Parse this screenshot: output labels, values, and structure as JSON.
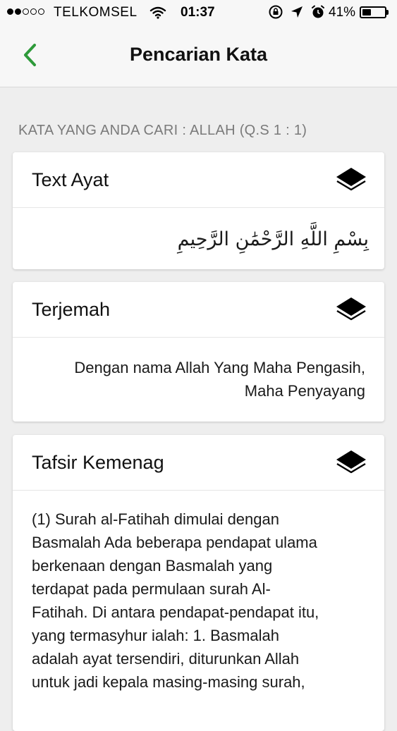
{
  "status_bar": {
    "carrier": "TELKOMSEL",
    "time": "01:37",
    "battery_percent": "41%",
    "battery_level": 0.41,
    "signal_bars_filled": 2,
    "signal_bars_total": 5,
    "icons": [
      "wifi-icon",
      "rotation-lock-icon",
      "location-icon",
      "alarm-icon",
      "battery-icon"
    ]
  },
  "nav": {
    "title": "Pencarian Kata",
    "back_icon": "chevron-left-icon",
    "accent_color": "#2e9a3a"
  },
  "search": {
    "header": "KATA YANG ANDA CARI : ALLAH (Q.S 1 : 1)"
  },
  "cards": [
    {
      "title": "Text Ayat",
      "icon": "layers-icon",
      "body": "بِسْمِ اللَّهِ الرَّحْمَٰنِ الرَّحِيمِ"
    },
    {
      "title": "Terjemah",
      "icon": "layers-icon",
      "body_line1": "Dengan nama Allah Yang Maha Pengasih,",
      "body_line2": "Maha Penyayang"
    },
    {
      "title": "Tafsir Kemenag",
      "icon": "layers-icon",
      "lines": [
        "(1) Surah al-Fatihah dimulai dengan",
        "Basmalah Ada beberapa pendapat ulama",
        "berkenaan dengan Basmalah yang",
        "terdapat pada permulaan surah Al-",
        "Fatihah. Di antara pendapat-pendapat itu,",
        "yang termasyhur ialah: 1. Basmalah",
        "adalah ayat tersendiri, diturunkan Allah",
        "untuk jadi kepala masing-masing surah,"
      ]
    }
  ]
}
